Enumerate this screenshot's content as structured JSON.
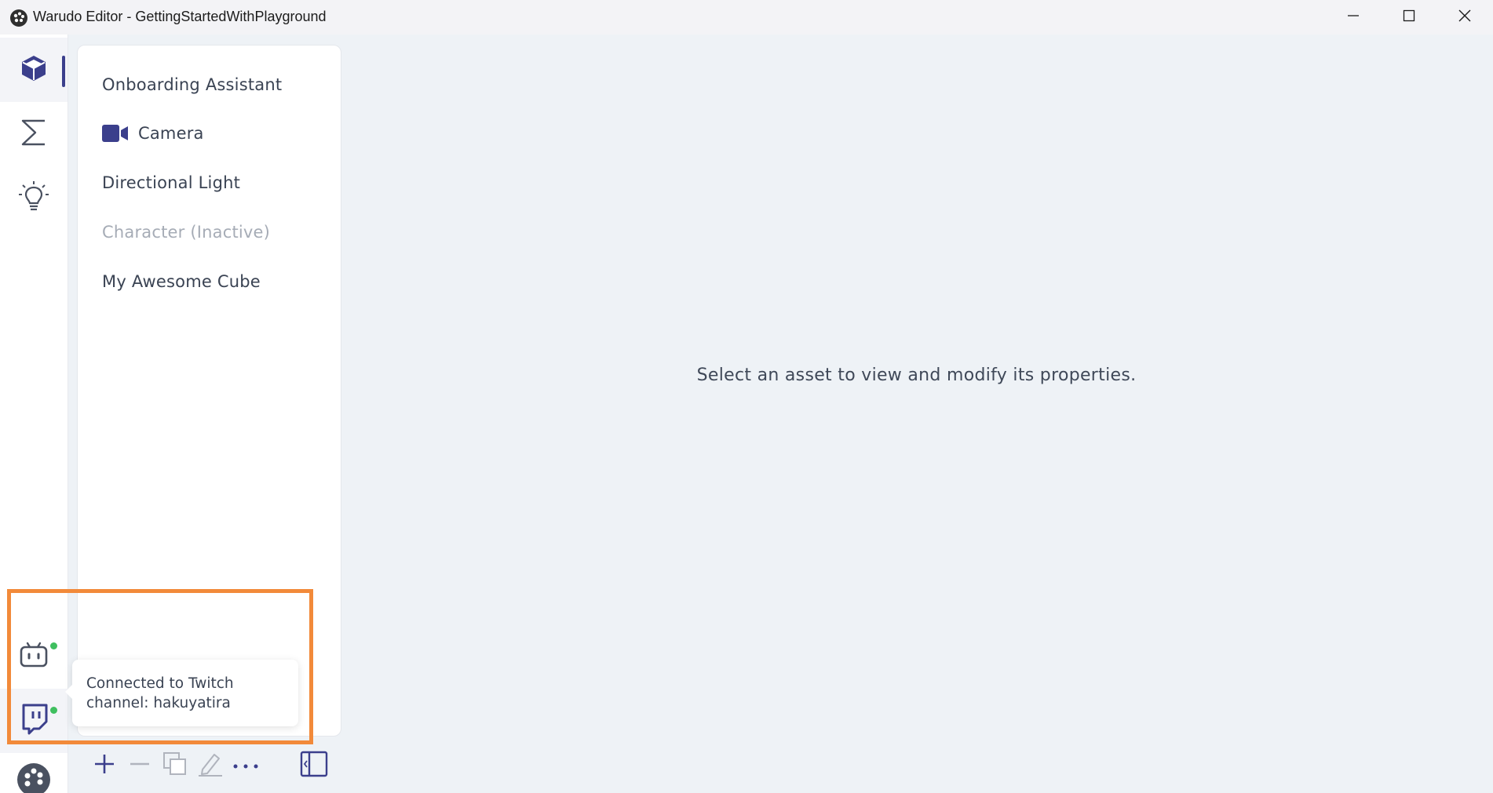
{
  "window": {
    "title": "Warudo Editor - GettingStartedWithPlayground",
    "icons": [
      "app-logo-icon",
      "minimize-icon",
      "maximize-icon",
      "close-icon"
    ]
  },
  "activity_bar": {
    "items": [
      {
        "name": "assets",
        "icon": "cube-icon",
        "active": true
      },
      {
        "name": "blueprints",
        "icon": "sigma-icon",
        "active": false
      },
      {
        "name": "tips",
        "icon": "lightbulb-icon",
        "active": false
      }
    ],
    "bottom_items": [
      {
        "name": "bilibili",
        "icon": "bilibili-icon",
        "status": "connected"
      },
      {
        "name": "twitch",
        "icon": "twitch-icon",
        "status": "connected"
      },
      {
        "name": "settings",
        "icon": "palette-icon"
      }
    ]
  },
  "asset_panel": {
    "items": [
      {
        "label": "Onboarding Assistant",
        "icon": null,
        "inactive": false
      },
      {
        "label": "Camera",
        "icon": "video-camera-icon",
        "inactive": false
      },
      {
        "label": "Directional Light",
        "icon": null,
        "inactive": false
      },
      {
        "label": "Character (Inactive)",
        "icon": null,
        "inactive": true
      },
      {
        "label": "My Awesome Cube",
        "icon": null,
        "inactive": false
      }
    ],
    "toolbar": [
      "plus-icon",
      "minus-icon",
      "duplicate-icon",
      "rename-icon",
      "more-icon",
      "collapse-panel-icon"
    ]
  },
  "main": {
    "placeholder": "Select an asset to view and modify its properties."
  },
  "tooltip": {
    "line1": "Connected to Twitch",
    "line2": "channel: hakuyatira"
  },
  "colors": {
    "accent": "#3b3f8c",
    "status_connected": "#3fbf5f",
    "highlight": "#f28a3a",
    "inactive_text": "#a6acb6"
  }
}
